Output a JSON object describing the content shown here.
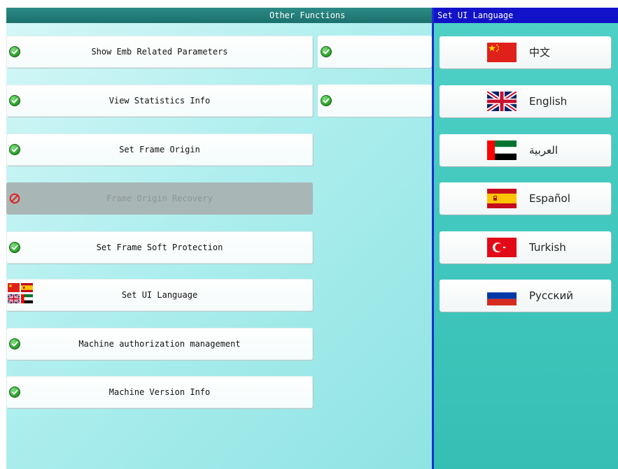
{
  "left_panel": {
    "title": "Other Functions",
    "buttons": [
      {
        "label": "Show Emb Related Parameters",
        "icon": "check-icon",
        "enabled": true
      },
      {
        "label": "View Statistics Info",
        "icon": "check-icon",
        "enabled": true
      },
      {
        "label": "Set Frame Origin",
        "icon": "check-icon",
        "enabled": true
      },
      {
        "label": "Frame Origin Recovery",
        "icon": "prohibited-icon",
        "enabled": false
      },
      {
        "label": "Set Frame Soft Protection",
        "icon": "check-icon",
        "enabled": true
      },
      {
        "label": "Set UI Language",
        "icon": "language-flags-icon",
        "enabled": true
      },
      {
        "label": "Machine authorization management",
        "icon": "check-icon",
        "enabled": true
      },
      {
        "label": "Machine Version Info",
        "icon": "check-icon",
        "enabled": true
      }
    ],
    "side_buttons": [
      {
        "label": "",
        "icon": "check-icon"
      },
      {
        "label": "",
        "icon": "check-icon"
      }
    ]
  },
  "right_panel": {
    "title": "Set UI Language",
    "languages": [
      {
        "label": "中文",
        "flag": "china-flag-icon"
      },
      {
        "label": "English",
        "flag": "uk-flag-icon"
      },
      {
        "label": "العربية",
        "flag": "uae-flag-icon"
      },
      {
        "label": "Español",
        "flag": "spain-flag-icon"
      },
      {
        "label": "Turkish",
        "flag": "turkey-flag-icon"
      },
      {
        "label": "Русский",
        "flag": "russia-flag-icon"
      }
    ]
  },
  "colors": {
    "header_dark_teal": "#1b706c",
    "right_header_blue": "#1212c8",
    "right_panel_teal": "#35bfb4",
    "left_panel_light": "#aeeeee",
    "disabled_button": "#a9b6b6",
    "check_green": "#2fa82f",
    "prohibited_red": "#e02020"
  }
}
